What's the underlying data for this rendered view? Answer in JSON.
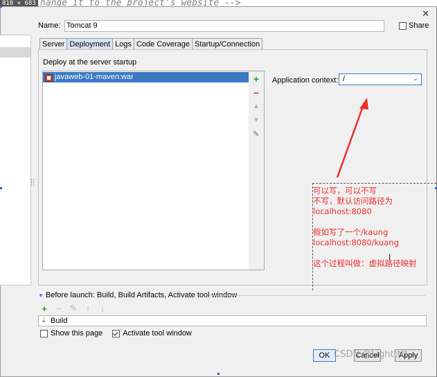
{
  "backdrop": {
    "dimension_label": "810 × 683",
    "code_line": "hange it to the project's website -->"
  },
  "dialog": {
    "close_glyph": "✕",
    "name_label": "Name:",
    "name_value": "Tomcat 9",
    "share_label": "Share",
    "share_checked": false,
    "tabs": [
      {
        "label": "Server",
        "active": false
      },
      {
        "label": "Deployment",
        "active": true
      },
      {
        "label": "Logs",
        "active": false
      },
      {
        "label": "Code Coverage",
        "active": false
      },
      {
        "label": "Startup/Connection",
        "active": false
      }
    ],
    "deployment": {
      "section_title": "Deploy at the server startup",
      "artifacts": [
        {
          "label": "javaweb-01-maven:war",
          "icon": "war-artifact-icon",
          "selected": true
        }
      ],
      "toolbar": {
        "add": "+",
        "remove": "−",
        "up": "▲",
        "down": "▼",
        "edit": "✎"
      },
      "application_context_label": "Application context:",
      "application_context_value": "/"
    },
    "before_launch": {
      "title": "Before launch: Build, Build Artifacts, Activate tool window",
      "toolbar": {
        "add": "+",
        "remove": "−",
        "edit": "✎",
        "up": "↑",
        "down": "↓"
      },
      "tasks": [
        {
          "label": "Build",
          "icon": "build-icon"
        }
      ]
    },
    "show_this_page_label": "Show this page",
    "show_this_page_checked": false,
    "activate_tool_window_label": "Activate tool window",
    "activate_tool_window_checked": true,
    "buttons": {
      "ok": "OK",
      "cancel": "Cancel",
      "apply": "Apply"
    }
  },
  "annotation": {
    "lines": "可以写，可以不写\n不写，默认访问路径为\nlocalhost:8080\n\n假如写了一个/kaung\nlocalhost:8080/kuang\n\n这个过程叫做：虚拟路径映射",
    "color": "#e8302a"
  },
  "watermark": "CSDN @Lighttttt"
}
